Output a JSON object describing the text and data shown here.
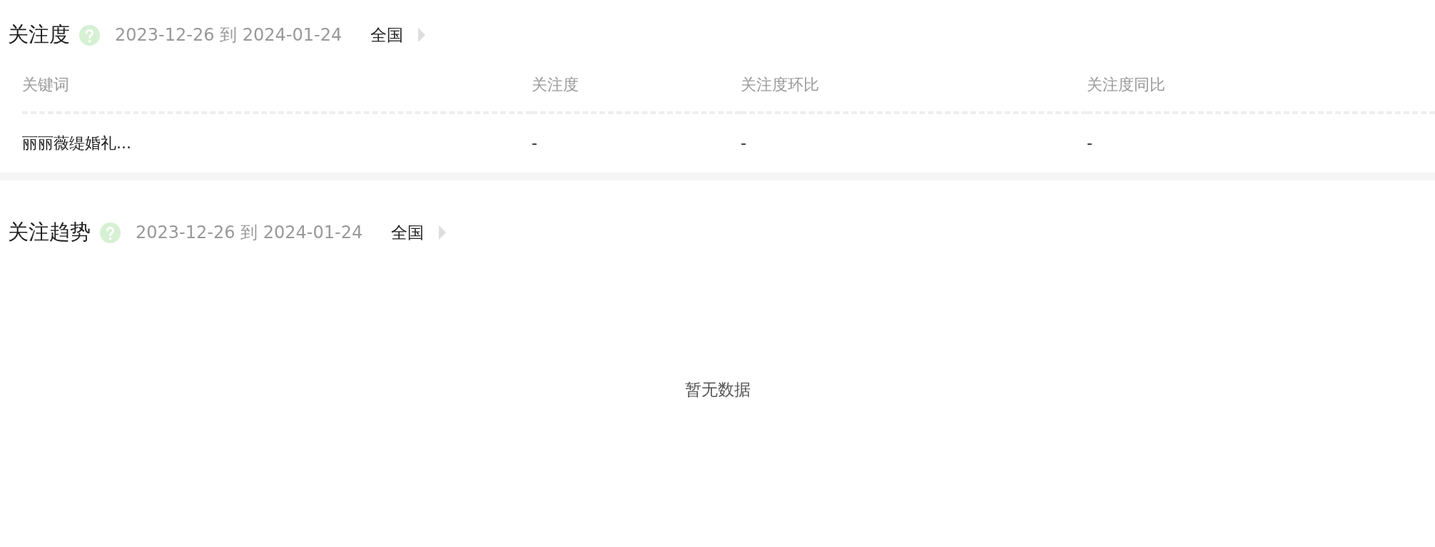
{
  "sections": [
    {
      "title": "关注度",
      "date_range": "2023-12-26 到 2024-01-24",
      "region": "全国",
      "table": {
        "columns": [
          "关键词",
          "关注度",
          "关注度环比",
          "关注度同比"
        ],
        "rows": [
          [
            "丽丽薇缇婚礼...",
            "-",
            "-",
            "-"
          ]
        ]
      }
    },
    {
      "title": "关注趋势",
      "date_range": "2023-12-26 到 2024-01-24",
      "region": "全国",
      "empty_text": "暂无数据"
    }
  ]
}
